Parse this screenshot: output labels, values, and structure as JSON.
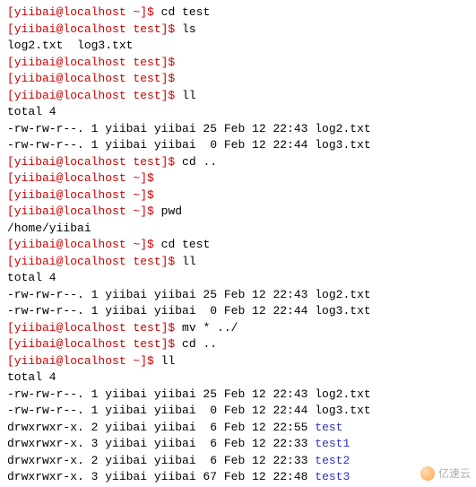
{
  "prompt1": "[yiibai@localhost ~]$ ",
  "prompt2": "[yiibai@localhost test]$ ",
  "cmd": {
    "cd_test": "cd test",
    "ls": "ls",
    "ll": "ll",
    "cd_up": "cd ..",
    "pwd": "pwd",
    "mv": "mv * ../"
  },
  "out": {
    "ls_files": "log2.txt  log3.txt",
    "total": "total 4",
    "pwd": "/home/yiibai",
    "rw_log2": "-rw-rw-r--. 1 yiibai yiibai 25 Feb 12 22:43 log2.txt",
    "rw_log3": "-rw-rw-r--. 1 yiibai yiibai  0 Feb 12 22:44 log3.txt",
    "d_test": "drwxrwxr-x. 2 yiibai yiibai  6 Feb 12 22:55 ",
    "d_test1": "drwxrwxr-x. 3 yiibai yiibai  6 Feb 12 22:33 ",
    "d_test2": "drwxrwxr-x. 2 yiibai yiibai  6 Feb 12 22:33 ",
    "d_test3": "drwxrwxr-x. 3 yiibai yiibai 67 Feb 12 22:48 "
  },
  "dirs": {
    "test": "test",
    "test1": "test1",
    "test2": "test2",
    "test3": "test3"
  },
  "watermark": "亿速云"
}
